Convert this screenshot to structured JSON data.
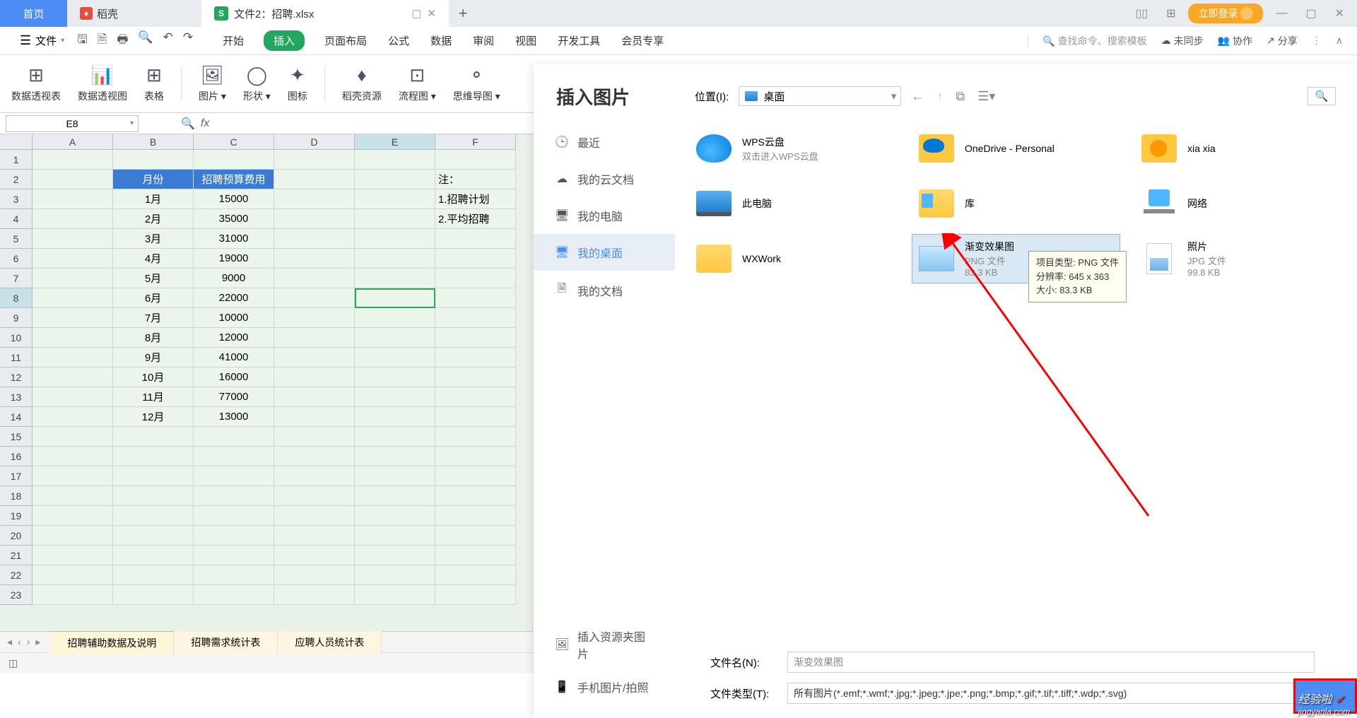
{
  "titlebar": {
    "home": "首页",
    "docer": "稻壳",
    "file_tab": "文件2：招聘.xlsx",
    "login": "立即登录"
  },
  "menubar": {
    "file": "文件",
    "items": [
      "开始",
      "插入",
      "页面布局",
      "公式",
      "数据",
      "审阅",
      "视图",
      "开发工具",
      "会员专享"
    ],
    "search_placeholder": "查找命令、搜索模板",
    "unsync": "未同步",
    "collab": "协作",
    "share": "分享"
  },
  "ribbon": {
    "btns": [
      "数据透视表",
      "数据透视图",
      "表格",
      "图片",
      "形状",
      "图标",
      "稻壳资源",
      "流程图",
      "思维导图"
    ]
  },
  "formula": {
    "name_box": "E8"
  },
  "columns": [
    "A",
    "B",
    "C",
    "D",
    "E",
    "F"
  ],
  "row_count": 23,
  "table": {
    "header": [
      "月份",
      "招聘预算费用"
    ],
    "rows": [
      [
        "1月",
        "15000"
      ],
      [
        "2月",
        "35000"
      ],
      [
        "3月",
        "31000"
      ],
      [
        "4月",
        "19000"
      ],
      [
        "5月",
        "9000"
      ],
      [
        "6月",
        "22000"
      ],
      [
        "7月",
        "10000"
      ],
      [
        "8月",
        "12000"
      ],
      [
        "9月",
        "41000"
      ],
      [
        "10月",
        "16000"
      ],
      [
        "11月",
        "77000"
      ],
      [
        "12月",
        "13000"
      ]
    ],
    "notes": [
      "注：",
      "1.招聘计划",
      "2.平均招聘"
    ]
  },
  "sheet_tabs": [
    "招聘辅助数据及说明",
    "招聘需求统计表",
    "应聘人员统计表"
  ],
  "dialog": {
    "title": "插入图片",
    "sidebar": [
      "最近",
      "我的云文档",
      "我的电脑",
      "我的桌面",
      "我的文档"
    ],
    "sidebar_active_index": 3,
    "location_label": "位置(I):",
    "location_value": "桌面",
    "files": [
      {
        "name": "WPS云盘",
        "sub": "双击进入WPS云盘",
        "icon": "cloud"
      },
      {
        "name": "OneDrive - Personal",
        "icon": "onedrive"
      },
      {
        "name": "xia xia",
        "icon": "user-folder"
      },
      {
        "name": "此电脑",
        "icon": "pc"
      },
      {
        "name": "库",
        "icon": "lib-folder"
      },
      {
        "name": "网络",
        "icon": "network"
      },
      {
        "name": "WXWork",
        "icon": "folder"
      },
      {
        "name": "渐变效果图",
        "sub": "PNG 文件",
        "sub2": "83.3 KB",
        "icon": "png",
        "selected": true
      },
      {
        "name": "照片",
        "sub": "JPG 文件",
        "sub2": "99.8 KB",
        "icon": "jpg"
      }
    ],
    "tooltip": {
      "l1": "项目类型: PNG 文件",
      "l2": "分辨率: 645 x 363",
      "l3": "大小: 83.3 KB"
    },
    "filename_label": "文件名(N):",
    "filename_value": "渐变效果图",
    "filetype_label": "文件类型(T):",
    "filetype_value": "所有图片(*.emf;*.wmf;*.jpg;*.jpeg;*.jpe;*.png;*.bmp;*.gif;*.tif;*.tiff;*.wdp;*.svg)",
    "sidebar_bottom": [
      "插入资源夹图片",
      "手机图片/拍照"
    ]
  },
  "watermark": {
    "text1": "经验啦",
    "text2": "jingyanla.com"
  }
}
